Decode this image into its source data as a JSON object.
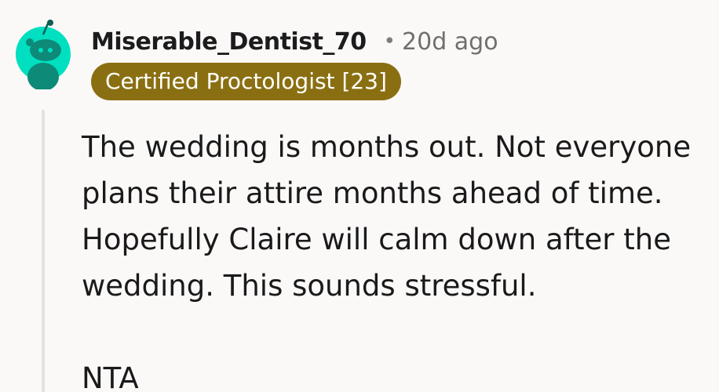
{
  "comment": {
    "username": "Miserable_Dentist_70",
    "separator": "•",
    "timestamp": "20d ago",
    "flair": "Certified Proctologist [23]",
    "paragraphs": [
      "The wedding is months out. Not everyone\nplans their attire months ahead of time.\nHopefully Claire will calm down after the\nwedding. This sounds stressful.",
      "NTA"
    ]
  },
  "avatar": {
    "icon": "reddit-snoo-avatar-icon",
    "color": "#00e0c0"
  },
  "colors": {
    "background": "#fbf9f8",
    "flair_background": "#8a6f12",
    "flair_text": "#ffffff",
    "thread_line": "#e6e1dd"
  }
}
